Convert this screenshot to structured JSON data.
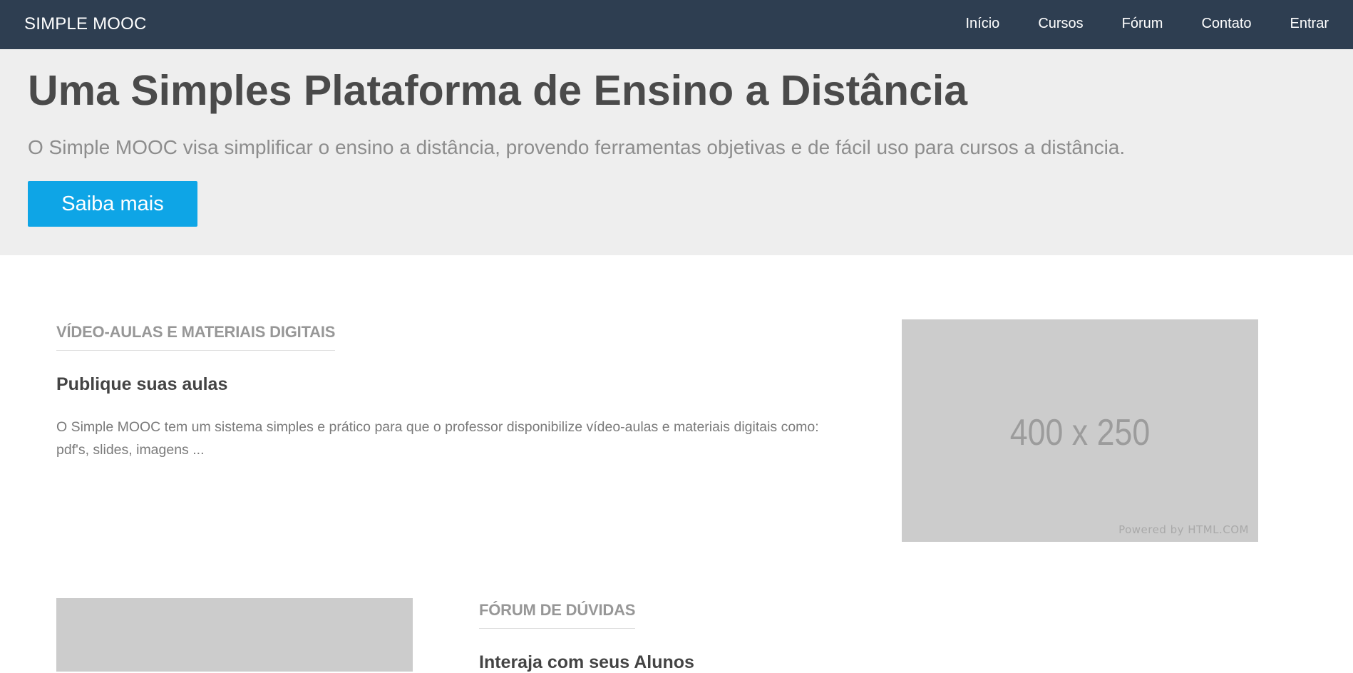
{
  "nav": {
    "brand": "SIMPLE MOOC",
    "links": [
      "Início",
      "Cursos",
      "Fórum",
      "Contato",
      "Entrar"
    ]
  },
  "hero": {
    "title": "Uma Simples Plataforma de Ensino a Distância",
    "subtitle": "O Simple MOOC visa simplificar o ensino a distância, provendo ferramentas objetivas e de fácil uso para cursos a distância.",
    "button_label": "Saiba mais"
  },
  "features": [
    {
      "heading": "VÍDEO-AULAS E MATERIAIS DIGITAIS",
      "title": "Publique suas aulas",
      "text": "O Simple MOOC tem um sistema simples e prático para que o professor disponibilize vídeo-aulas e materiais digitais como: pdf's, slides, imagens ...",
      "image": {
        "size_label": "400 x 250",
        "credit": "Powered by HTML.COM"
      }
    },
    {
      "heading": "FÓRUM DE DÚVIDAS",
      "title": "Interaja com seus Alunos"
    }
  ],
  "colors": {
    "navbar_bg": "#2e3e51",
    "hero_bg": "#eeeeee",
    "accent": "#0ea5e6",
    "placeholder_bg": "#cccccc"
  }
}
